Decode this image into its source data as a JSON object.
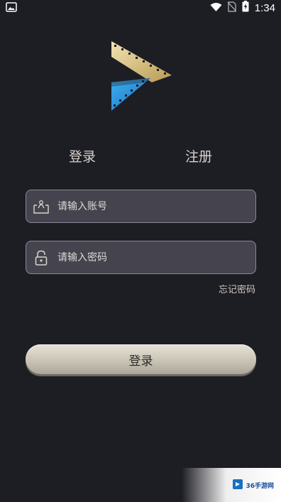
{
  "status_bar": {
    "time": "1:34",
    "icons": [
      "image-icon",
      "wifi-icon",
      "no-sim-icon",
      "battery-charging-icon"
    ]
  },
  "tabs": {
    "login": "登录",
    "register": "注册"
  },
  "account_field": {
    "placeholder": "请输入账号",
    "icon": "account-icon"
  },
  "password_field": {
    "placeholder": "请输入密码",
    "icon": "lock-icon"
  },
  "forgot_password": "忘记密码",
  "login_button": "登录",
  "watermark": {
    "text": "36手游网"
  },
  "colors": {
    "background": "#1d1d24",
    "field_bg": "#45444e",
    "field_border": "#8a8895",
    "button_gold": "#d4cfc2",
    "logo_gold": "#d9c48a",
    "logo_blue": "#2b8fd6"
  }
}
